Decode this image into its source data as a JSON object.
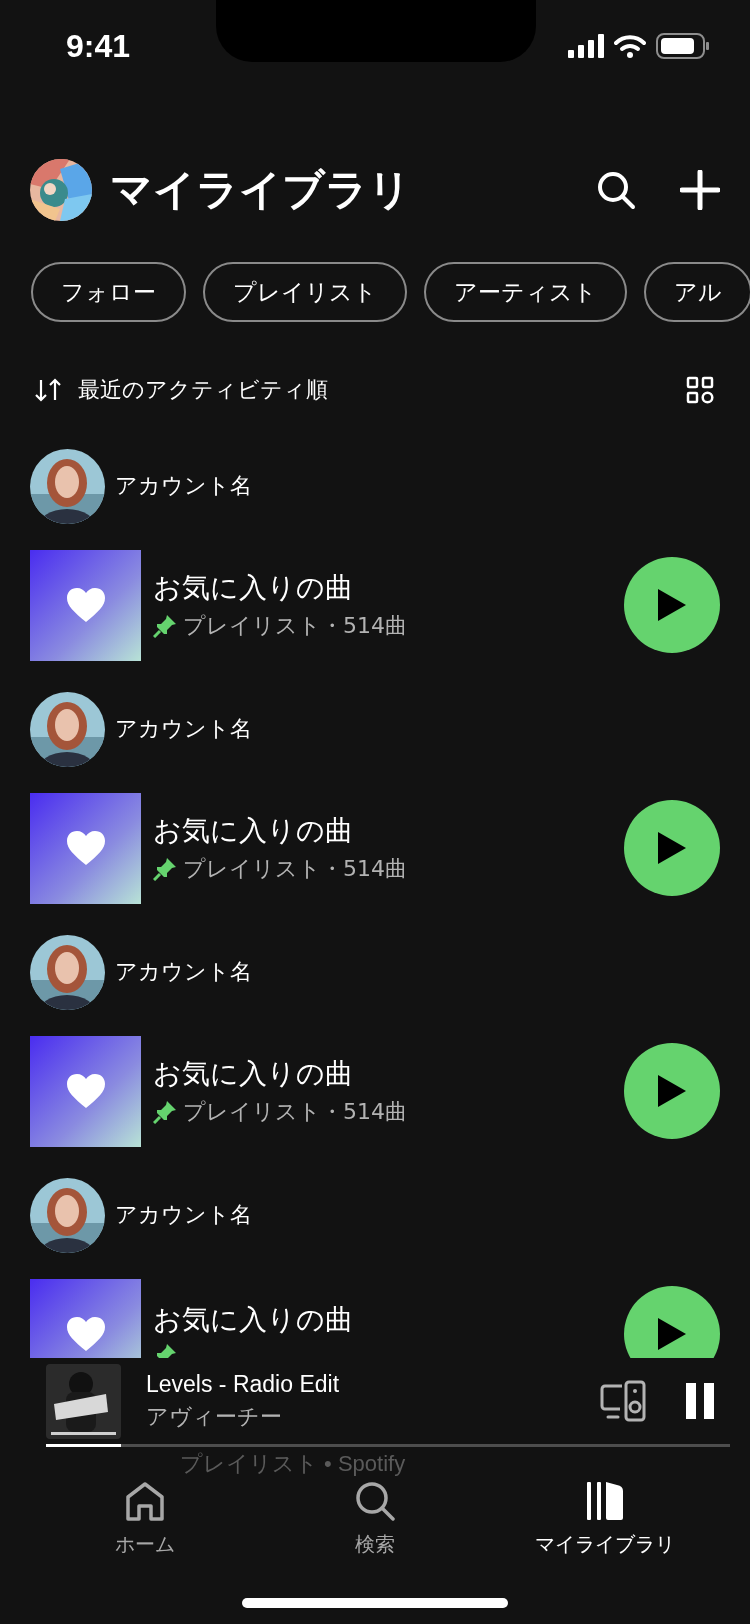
{
  "status_bar": {
    "time": "9:41"
  },
  "header": {
    "title": "マイライブラリ"
  },
  "filters": [
    {
      "label": "フォロー",
      "selected": false
    },
    {
      "label": "プレイリスト",
      "selected": false
    },
    {
      "label": "アーティスト",
      "selected": false
    },
    {
      "label": "アル",
      "selected": false
    }
  ],
  "sort": {
    "label": "最近のアクティビティ順"
  },
  "items": [
    {
      "account": "アカウント名",
      "title": "お気に入りの曲",
      "subtitle": "プレイリスト・514曲",
      "pinned": true
    },
    {
      "account": "アカウント名",
      "title": "お気に入りの曲",
      "subtitle": "プレイリスト・514曲",
      "pinned": true
    },
    {
      "account": "アカウント名",
      "title": "お気に入りの曲",
      "subtitle": "プレイリスト・514曲",
      "pinned": true
    },
    {
      "account": "アカウント名",
      "title": "お気に入りの曲",
      "pinned": true
    }
  ],
  "now_playing": {
    "title": "Levels - Radio Edit",
    "artist": "アヴィーチー",
    "level": 0.11,
    "playing": true
  },
  "behind_text": "プレイリスト • Spotify",
  "tabs": [
    {
      "label": "ホーム",
      "selected": false,
      "kind": "home"
    },
    {
      "label": "検索",
      "selected": false,
      "kind": "search"
    },
    {
      "label": "マイライブラリ",
      "selected": true,
      "kind": "library"
    }
  ]
}
